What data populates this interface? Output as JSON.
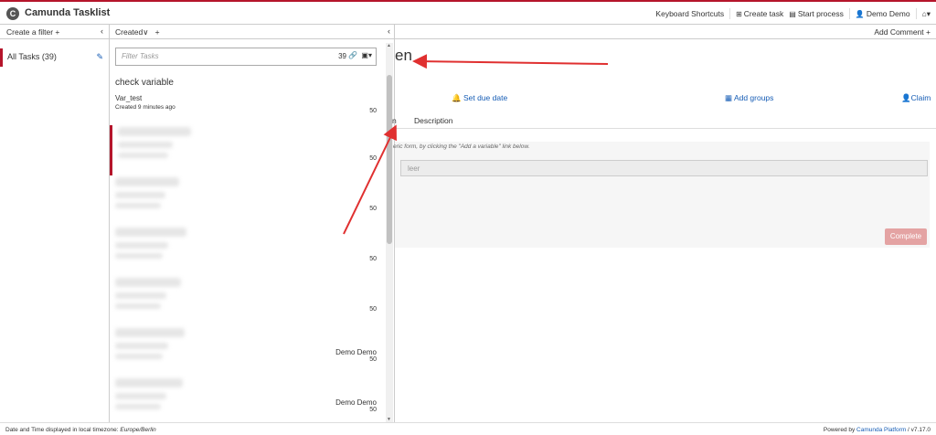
{
  "header": {
    "logo_glyph": "C",
    "title": "Camunda Tasklist",
    "nav": {
      "keyboard_shortcuts": "Keyboard Shortcuts",
      "create_task": "Create task",
      "start_process": "Start process",
      "user": "Demo Demo"
    }
  },
  "filters": {
    "create_label": "Create a filter",
    "items": [
      {
        "label": "All Tasks (39)"
      }
    ]
  },
  "task_list": {
    "sort_label": "Created",
    "search_placeholder": "Filter Tasks",
    "count": "39",
    "tasks": [
      {
        "name": "check variable",
        "process": "Var_test",
        "created": "Created 9 minutes ago",
        "priority": "50"
      },
      {
        "priority": "50"
      },
      {
        "priority": "50"
      },
      {
        "priority": "50"
      },
      {
        "priority": "50"
      },
      {
        "assignee": "Demo Demo",
        "priority": "50"
      },
      {
        "assignee": "Demo Demo",
        "priority": "50"
      }
    ]
  },
  "detail": {
    "add_comment": "Add Comment",
    "title_fragment": "en",
    "actions": {
      "due_date": "Set due date",
      "groups": "Add groups",
      "claim": "Claim"
    },
    "tabs": [
      "n",
      "Description"
    ],
    "form_note": "eric form, by clicking the \"Add a variable\" link below.",
    "field_value": "leer",
    "complete_label": "Complete"
  },
  "footer": {
    "timezone_prefix": "Date and Time displayed in local timezone: ",
    "timezone": "Europe/Berlin",
    "powered_prefix": "Powered by ",
    "powered_link": "Camunda Platform",
    "version": " / v7.17.0"
  },
  "colors": {
    "accent": "#b5152b",
    "link": "#155cb5",
    "annotation_arrow": "#e03030"
  },
  "icons": [
    "pencil-icon",
    "link-icon",
    "save-icon",
    "bell-icon",
    "grid-icon",
    "user-icon",
    "home-icon",
    "plus-icon",
    "chevron-left-icon"
  ]
}
